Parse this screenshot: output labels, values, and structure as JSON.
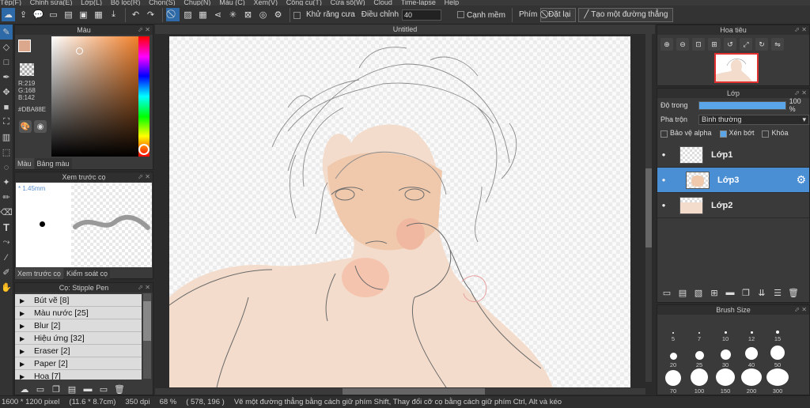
{
  "menu": [
    "Tệp(F)",
    "Chỉnh sửa(E)",
    "Lớp(L)",
    "Bộ lọc(R)",
    "Chọn(S)",
    "Chụp(N)",
    "Màu (C)",
    "Xem(V)",
    "Công cụ(T)",
    "Cửa sổ(W)",
    "Cloud",
    "Time-lapse",
    "Help"
  ],
  "toolbar": {
    "antialias_label": "Khử răng cưa",
    "adjust_label": "Điều chỉnh",
    "adjust_value": "40",
    "edge_label": "Cạnh mềm",
    "key_label": "Phím",
    "reset_label": "Đặt lại",
    "line_label": "Tạo một đường thẳng"
  },
  "color_panel": {
    "title": "Màu",
    "r": "R:219",
    "g": "G:168",
    "b": "B:142",
    "hex": "#DBA88E",
    "fg_color": "#DBA88E",
    "tabs": [
      "Màu",
      "Bảng màu"
    ]
  },
  "brush_preview": {
    "title": "Xem trước cọ",
    "size": "* 1.45mm",
    "tabs": [
      "Xem trước cọ",
      "Kiểm soát cọ"
    ]
  },
  "brush_list": {
    "title": "Cọ: Stipple Pen",
    "items": [
      "Bút vẽ [8]",
      "Màu nước [25]",
      "Blur [2]",
      "Hiệu ứng [32]",
      "Eraser [2]",
      "Paper [2]",
      "Hoạ [7]"
    ]
  },
  "canvas": {
    "title": "Untitled"
  },
  "navigator": {
    "title": "Hoa tiêu"
  },
  "layers": {
    "title": "Lớp",
    "opacity_label": "Độ trong",
    "opacity_value": "100 %",
    "opacity_fraction": 1.0,
    "blend_label": "Pha trộn",
    "blend_value": "Bình thường",
    "opt_alpha": "Bảo vệ alpha",
    "opt_clip": "Xén bớt",
    "opt_lock": "Khóa",
    "items": [
      {
        "name": "Lớp1",
        "selected": false
      },
      {
        "name": "Lớp3",
        "selected": true
      },
      {
        "name": "Lớp2",
        "selected": false
      }
    ]
  },
  "brush_size": {
    "title": "Brush Size",
    "sizes": [
      "5",
      "7",
      "10",
      "12",
      "15",
      "20",
      "25",
      "30",
      "40",
      "50",
      "70",
      "100",
      "150",
      "200",
      "300"
    ]
  },
  "status": {
    "dims": "1600 * 1200 pixel",
    "cm": "(11.6 * 8.7cm)",
    "dpi": "350 dpi",
    "zoom": "68 %",
    "coords": "( 578, 196 )",
    "hint": "Vẽ một đường thẳng bằng cách giữ phím Shift, Thay đổi cỡ cọ bằng cách giữ phím Ctrl, Alt và kéo"
  }
}
